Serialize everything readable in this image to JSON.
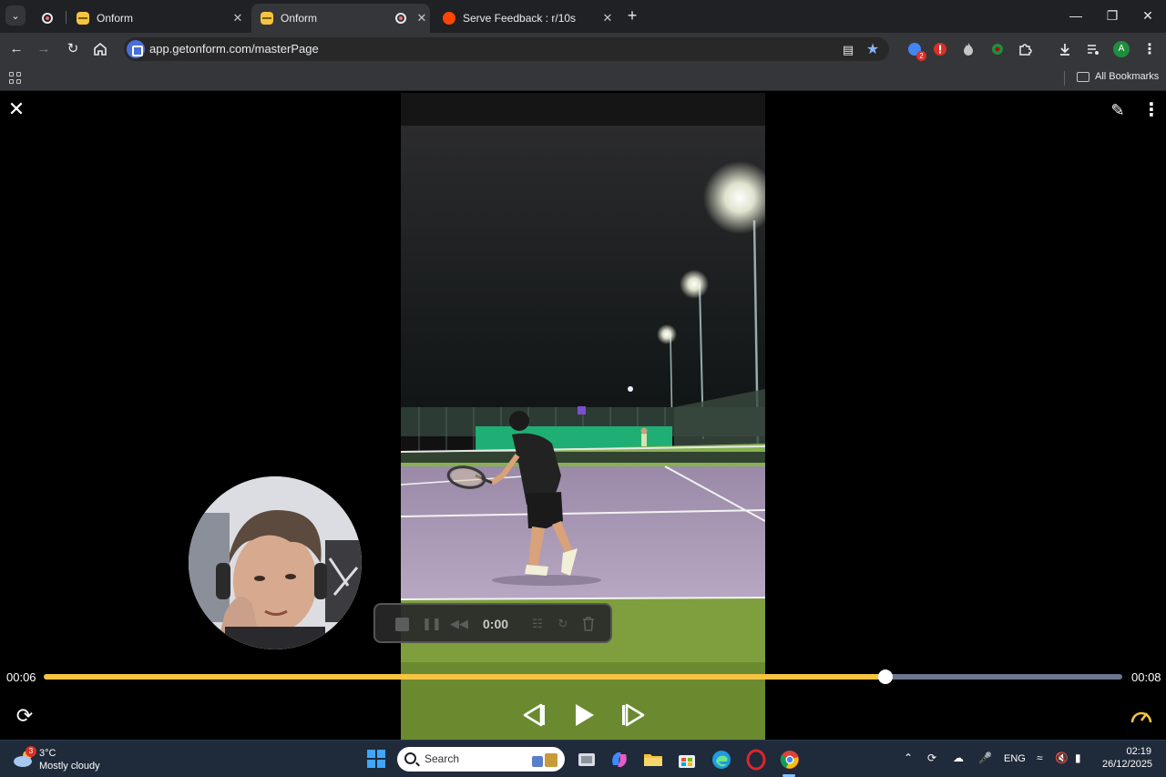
{
  "browser": {
    "tabs": [
      {
        "label": "Onform",
        "active": false,
        "recording": false
      },
      {
        "label": "Onform",
        "active": true,
        "recording": true
      },
      {
        "label": "Serve Feedback : r/10s",
        "active": false,
        "recording": false
      }
    ],
    "url": "app.getonform.com/masterPage",
    "bookmarks_label": "All Bookmarks",
    "extension_badge": "2",
    "profile_initial": "A"
  },
  "viewer": {
    "time_current": "00:06",
    "time_total": "00:08",
    "progress": 0.78
  },
  "recorder": {
    "elapsed": "0:00"
  },
  "taskbar": {
    "weather_temp": "3°C",
    "weather_condition": "Mostly cloudy",
    "weather_badge": "3",
    "search_placeholder": "Search",
    "language": "ENG",
    "time": "02:19",
    "date": "26/12/2025"
  },
  "colors": {
    "accent": "#f6c343",
    "track": "#6b7890"
  }
}
